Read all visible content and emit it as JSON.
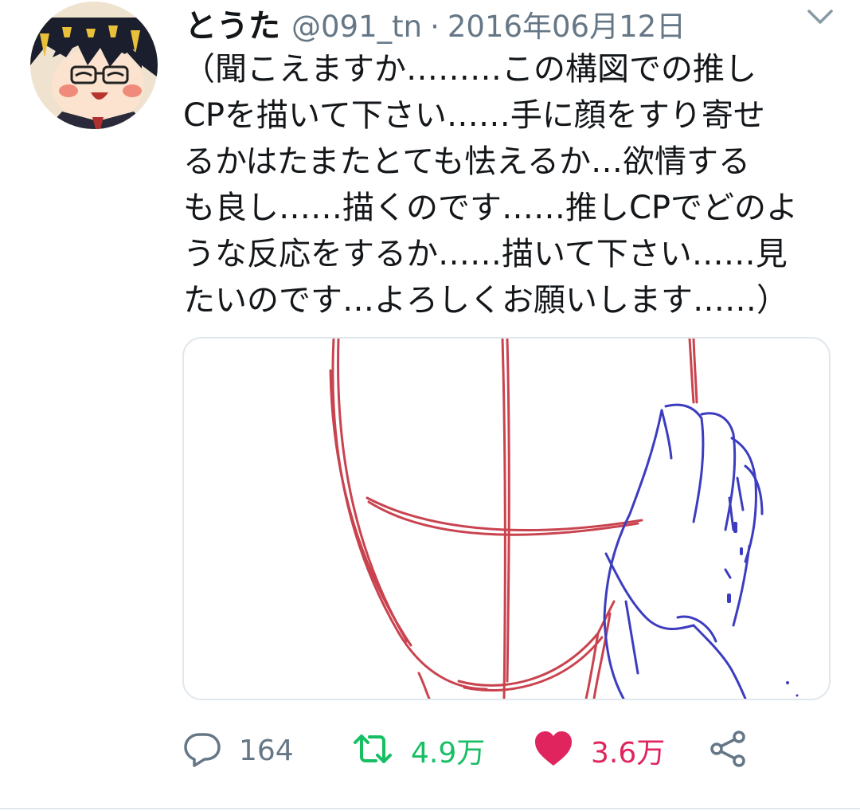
{
  "tweet": {
    "display_name": "とうた",
    "handle": "@091_tn",
    "separator": "·",
    "date": "2016年06月12日",
    "text": "（聞こえますか………この構図での推し\nCPを描いて下さい……手に顔をすり寄せ\nるかはたまたとても怯えるか…欲情する\nも良し……描くのです……推しCPでどのよ\nうな反応をするか……描いて下さい……見\nたいのです…よろしくお願いします……）"
  },
  "actions": {
    "reply": {
      "icon": "reply-icon",
      "count": "164",
      "color": "#657786"
    },
    "retweet": {
      "icon": "retweet-icon",
      "count": "4.9万",
      "color": "#17bf63"
    },
    "like": {
      "icon": "heart-icon",
      "count": "3.6万",
      "color": "#e0245e"
    },
    "share": {
      "icon": "share-icon",
      "color": "#657786"
    }
  },
  "colors": {
    "text_primary": "#14171a",
    "text_secondary": "#657786",
    "sketch_red": "#c9434f",
    "sketch_blue": "#3c3cc0",
    "divider": "#e1e8ed"
  }
}
